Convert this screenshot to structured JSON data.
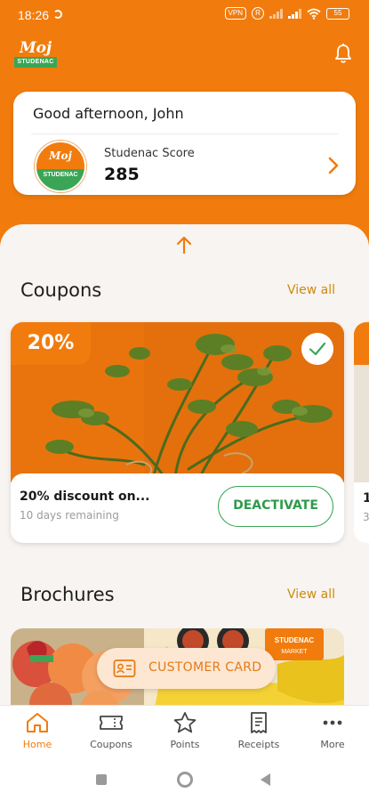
{
  "status_bar": {
    "time": "18:26",
    "vpn": "VPN",
    "r_badge": "R",
    "battery": "55"
  },
  "header": {
    "logo_top": "Moj",
    "logo_band": "STUDENAC",
    "bell_icon": "bell-icon"
  },
  "greeting_card": {
    "greeting": "Good afternoon, John",
    "badge_top": "Moj",
    "badge_band": "STUDENAC",
    "score_label": "Studenac Score",
    "score_value": "285"
  },
  "coupons": {
    "title": "Coupons",
    "view_all": "View all",
    "items": [
      {
        "discount": "20%",
        "title": "20% discount on...",
        "remaining": "10 days remaining",
        "action": "DEACTIVATE",
        "activated": true
      },
      {
        "title": "1",
        "remaining": "3"
      }
    ]
  },
  "brochures": {
    "title": "Brochures",
    "view_all": "View all",
    "store_label": "STUDENAC",
    "store_sub": "MARKET"
  },
  "customer_card": {
    "label": "CUSTOMER CARD"
  },
  "bottom_nav": {
    "items": [
      {
        "label": "Home",
        "icon": "home-icon",
        "active": true
      },
      {
        "label": "Coupons",
        "icon": "ticket-icon",
        "active": false
      },
      {
        "label": "Points",
        "icon": "star-icon",
        "active": false
      },
      {
        "label": "Receipts",
        "icon": "receipt-icon",
        "active": false
      },
      {
        "label": "More",
        "icon": "more-icon",
        "active": false
      }
    ]
  },
  "colors": {
    "brand_orange": "#f17c0d",
    "brand_green": "#3aa655",
    "link_gold": "#cc8b0e",
    "background": "#f7f4f1"
  }
}
